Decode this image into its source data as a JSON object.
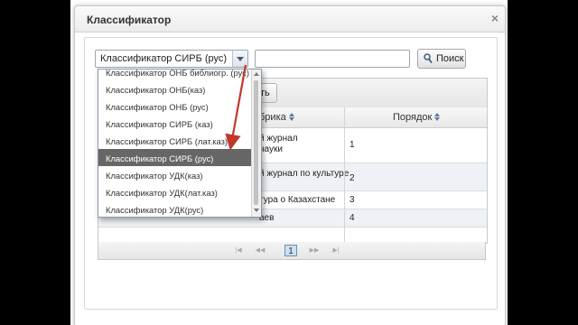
{
  "dialog": {
    "title": "Классификатор",
    "close_symbol": "×"
  },
  "search": {
    "selected_classifier": "Классификатор СИРБ (рус)",
    "query_value": "",
    "button_label": "Поиск"
  },
  "toolbar": {
    "button_partial_label": "рать"
  },
  "table": {
    "headers": [
      {
        "label": "брика"
      },
      {
        "label": "Порядок"
      }
    ],
    "rows": [
      {
        "name_line1": "й журнал",
        "name_line2": "науки",
        "order": "1"
      },
      {
        "name_line1": "й журнал по культуре",
        "name_line2": "",
        "order": "2"
      },
      {
        "name_line1": "тура о Казахстане",
        "name_line2": "",
        "order": "3"
      },
      {
        "name_line1": "аев",
        "name_line2": "",
        "order": "4"
      }
    ]
  },
  "pager": {
    "first": "|◀",
    "prev": "◀◀",
    "current_page": "1",
    "next": "▶▶",
    "last": "▶|"
  },
  "dropdown": {
    "items": [
      "Классификатор ОНБ библиогр. (рус)",
      "Классификатор ОНБ(каз)",
      "Классификатор ОНБ (рус)",
      "Классификатор СИРБ (каз)",
      "Классификатор СИРБ (лат.каз)",
      "Классификатор СИРБ (рус)",
      "Классификатор УДК(каз)",
      "Классификатор УДК(лат.каз)",
      "Классификатор УДК(рус)"
    ],
    "selected_index": 5
  },
  "colors": {
    "annotation_arrow": "#c0392b",
    "selected_item_bg": "#666666",
    "row_alt_bg": "#eef2f6"
  },
  "icons": {
    "search": "magnifier-icon",
    "select": "chevron-down-icon",
    "sort": "sort-icon"
  }
}
